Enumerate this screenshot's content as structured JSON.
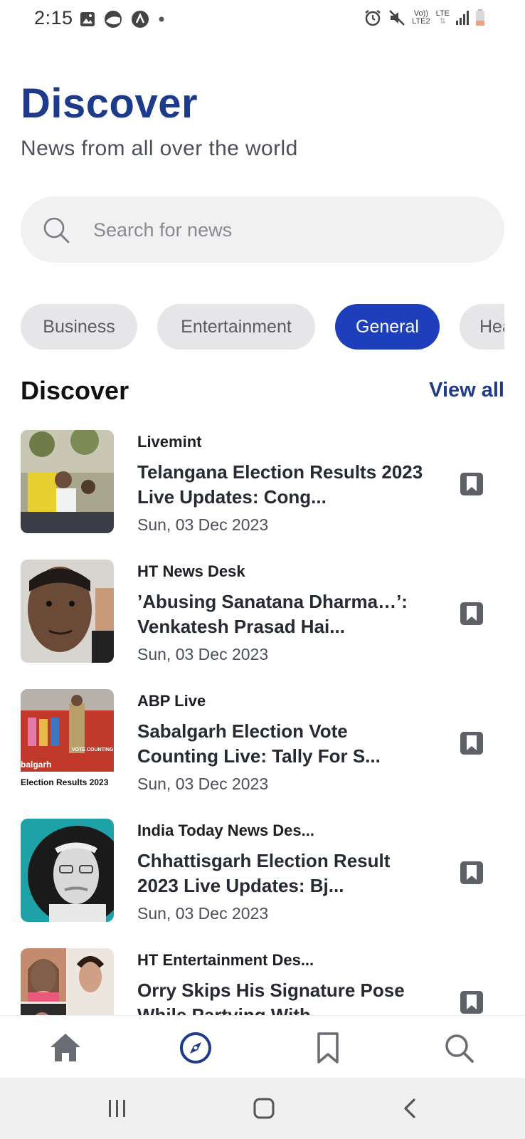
{
  "status_bar": {
    "time": "2:15",
    "left_icons": [
      "gallery-icon",
      "app-icon",
      "assistant-icon",
      "dot-icon"
    ],
    "right_icons": [
      "alarm-icon",
      "mute-icon",
      "volte-icon",
      "lte-icon",
      "signal-icon",
      "battery-icon"
    ],
    "volte_text": "Vo))",
    "volte_sub": "LTE2",
    "lte_text": "LTE"
  },
  "header": {
    "title": "Discover",
    "subtitle": "News from all over the world"
  },
  "search": {
    "placeholder": "Search for news",
    "value": ""
  },
  "categories": [
    {
      "label": "Business",
      "active": false
    },
    {
      "label": "Entertainment",
      "active": false
    },
    {
      "label": "General",
      "active": true
    },
    {
      "label": "Hea",
      "active": false
    }
  ],
  "section": {
    "title": "Discover",
    "view_all": "View all"
  },
  "news": [
    {
      "source": "Livemint",
      "headline": "Telangana Election Results 2023 Live Updates: Cong...",
      "date": "Sun, 03 Dec 2023"
    },
    {
      "source": "HT News Desk",
      "headline": "’Abusing Sanatana Dharma…’: Venkatesh Prasad Hai...",
      "date": "Sun, 03 Dec 2023"
    },
    {
      "source": "ABP Live",
      "headline": "Sabalgarh Election Vote Counting Live: Tally For S...",
      "date": "Sun, 03 Dec 2023",
      "thumb_caption": "Election Results 2023",
      "thumb_tag": "VOTE COUNTING",
      "thumb_place": "balgarh"
    },
    {
      "source": "India Today News Des...",
      "headline": "Chhattisgarh Election Result 2023 Live Updates: Bj...",
      "date": "Sun, 03 Dec 2023"
    },
    {
      "source": "HT Entertainment Des...",
      "headline": "Orry Skips His Signature Pose While Partying With...",
      "date": ""
    }
  ],
  "bottom_nav": [
    {
      "name": "home-icon",
      "active": false
    },
    {
      "name": "compass-icon",
      "active": true
    },
    {
      "name": "bookmark-icon",
      "active": false
    },
    {
      "name": "search-icon",
      "active": false
    }
  ],
  "colors": {
    "accent": "#1e3a8a",
    "chip_active": "#1d3fbb",
    "chip_inactive": "#e6e6e8",
    "search_bg": "#f1f1f2"
  }
}
